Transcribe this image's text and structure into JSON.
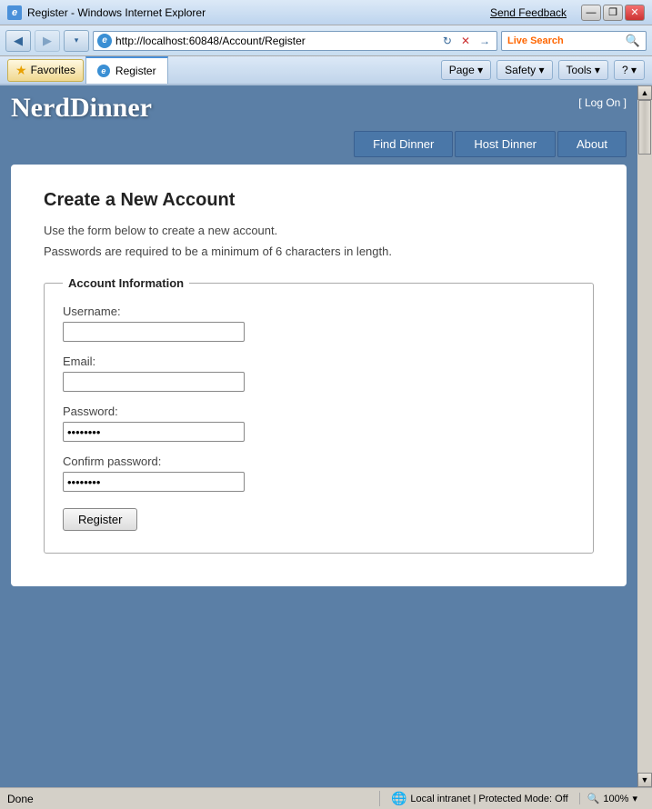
{
  "titlebar": {
    "icon_label": "e",
    "title": "Register - Windows Internet Explorer",
    "send_feedback": "Send Feedback",
    "minimize": "—",
    "restore": "❐",
    "close": "✕"
  },
  "addressbar": {
    "url": "http://localhost:60848/Account/Register",
    "live_search_placeholder": "Live Search",
    "ie_logo": "e",
    "go_symbol": "→",
    "refresh_symbol": "↻",
    "stop_symbol": "✕"
  },
  "toolbar": {
    "favorites_label": "Favorites",
    "tab_label": "Register",
    "page_btn": "Page",
    "safety_btn": "Safety",
    "tools_btn": "Tools",
    "help_symbol": "?",
    "chevron": "▾"
  },
  "navigation": {
    "login_text": "[ Log On ]",
    "find_dinner": "Find Dinner",
    "host_dinner": "Host Dinner",
    "about": "About"
  },
  "logo": {
    "text": "NerdDinner"
  },
  "page": {
    "title": "Create a New Account",
    "description1": "Use the form below to create a new account.",
    "description2": "Passwords are required to be a minimum of 6 characters in length.",
    "fieldset_legend": "Account Information",
    "username_label": "Username:",
    "email_label": "Email:",
    "password_label": "Password:",
    "password_value": "••••••",
    "confirm_password_label": "Confirm password:",
    "confirm_password_value": "••••••",
    "register_btn": "Register"
  },
  "statusbar": {
    "status": "Done",
    "security": "Local intranet | Protected Mode: Off",
    "zoom": "100%",
    "globe_icon": "🌐",
    "lock_icon": "🔒",
    "zoom_symbol": "🔍"
  }
}
